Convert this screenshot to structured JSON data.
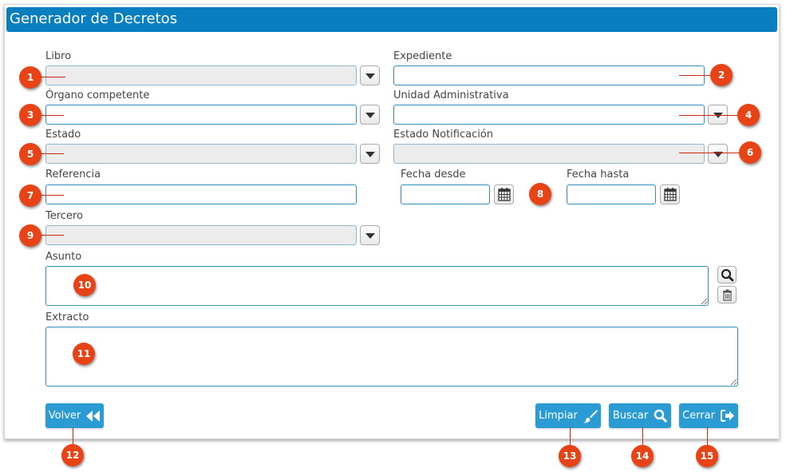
{
  "header": {
    "title": "Generador de Decretos"
  },
  "labels": {
    "libro": "Libro",
    "expediente": "Expediente",
    "organo": "Órgano competente",
    "unidad": "Unidad Administrativa",
    "estado": "Estado",
    "estado_notificacion": "Estado Notificación",
    "referencia": "Referencia",
    "fecha_desde": "Fecha desde",
    "fecha_hasta": "Fecha hasta",
    "tercero": "Tercero",
    "asunto": "Asunto",
    "extracto": "Extracto"
  },
  "fields": {
    "libro": "",
    "expediente": "",
    "organo": "",
    "unidad": "",
    "estado": "",
    "estado_notificacion": "",
    "referencia": "",
    "fecha_desde": "",
    "fecha_hasta": "",
    "tercero": "",
    "asunto": "",
    "extracto": ""
  },
  "buttons": {
    "volver": "Volver",
    "limpiar": "Limpiar",
    "buscar": "Buscar",
    "cerrar": "Cerrar"
  },
  "badges": [
    "1",
    "2",
    "3",
    "4",
    "5",
    "6",
    "7",
    "8",
    "9",
    "10",
    "11",
    "12",
    "13",
    "14",
    "15"
  ],
  "colors": {
    "header": "#0a7fc0",
    "button": "#2b9bd3",
    "badge": "#e84316",
    "field_border": "#2f8fbd"
  }
}
